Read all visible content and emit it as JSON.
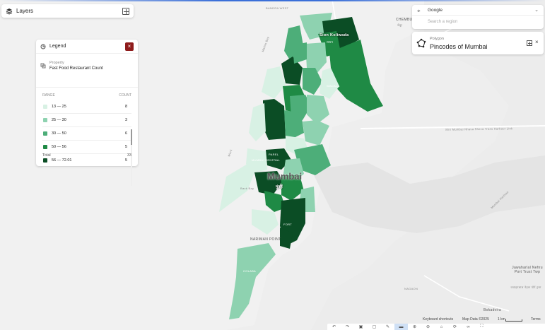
{
  "layers_panel": {
    "title": "Layers",
    "icon": "layers-icon",
    "add_icon": "add-layer-icon"
  },
  "legend": {
    "title": "Legend",
    "property_label": "Property",
    "property_value": "Fast Food Restaurant Count",
    "range_header": "RANGE",
    "count_header": "COUNT",
    "rows": [
      {
        "range": "13  —  25",
        "count": "8",
        "color": "#d8f1e4"
      },
      {
        "range": "25  —  30",
        "count": "3",
        "color": "#8ed2b0"
      },
      {
        "range": "30  —  50",
        "count": "6",
        "color": "#4dae79"
      },
      {
        "range": "50  —  56",
        "count": "5",
        "color": "#1f8a45"
      },
      {
        "range": "56  —  72.01",
        "count": "5",
        "color": "#0b4d25"
      }
    ],
    "total_label": "Total",
    "total_value": "33"
  },
  "search": {
    "provider": "Google",
    "placeholder": "Search a region"
  },
  "polygon_card": {
    "label": "Polygon",
    "name": "Pincodes of Mumbai"
  },
  "map_labels": {
    "bandra_west": "BANDRA WEST",
    "chembur": "CHEMBUR",
    "chembur_hindi": "चेंबूर",
    "sion_koliwada": "Sion Koliwada",
    "sion_hindi": "सायन",
    "wadala": "WADALA",
    "mahim_bay": "Mahim Bay",
    "worli": "Worli",
    "mumbai": "Mumbai",
    "mumbai_hindi": "मुंबई",
    "mumbai_central": "MUMBAI CENTRAL",
    "fort": "FORT",
    "nariman_point": "NARIMAN POINT",
    "colaba": "COLABA",
    "parel": "PAREL",
    "back_bay": "Back Bay",
    "harbour_link": "Shri Mumbai Nhava Sheva Trans Harbour Link",
    "jawaharlal_nehru_port": "Jawaharlal Nehru Port Trust Twp",
    "jnpt_hindi": "जवाहरलाल नेहरू पोर्ट ट्रस्ट",
    "bokadvira": "Bokadvira",
    "nagaon": "NAGAON",
    "mumbai_harbour": "Mumbai Harbour"
  },
  "attribution": {
    "keyboard": "Keyboard shortcuts",
    "map_data": "Map Data ©2025",
    "scale": "1 km",
    "terms": "Terms"
  },
  "toolbar_icons": [
    "undo-icon",
    "redo-icon",
    "selection-icon",
    "pin-icon",
    "draw-icon",
    "measure-icon",
    "zoom-in-icon",
    "zoom-out-icon",
    "layers-toggle-icon",
    "rotate-icon",
    "link-icon",
    "fullscreen-icon"
  ],
  "colors": {
    "accent": "#8e1b1b",
    "primary_blue": "#3a6fd8"
  }
}
